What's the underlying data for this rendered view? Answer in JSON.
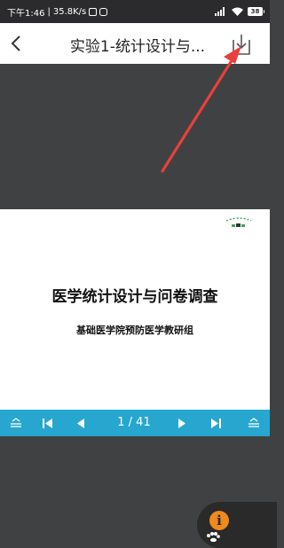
{
  "status_bar": {
    "time": "下午1:46",
    "separator": "|",
    "speed": "35.8K/s",
    "battery": "38"
  },
  "header": {
    "title": "实验1-统计设计与..."
  },
  "slide": {
    "title": "医学统计设计与问卷调查",
    "subtitle": "基础医学院预防医学教研组"
  },
  "pager": {
    "counter": "1 / 41"
  },
  "info_button": {
    "glyph": "i"
  },
  "colors": {
    "pager": "#27a7cf",
    "background": "#404143",
    "arrow": "#e8403a",
    "info": "#f08a1c"
  }
}
